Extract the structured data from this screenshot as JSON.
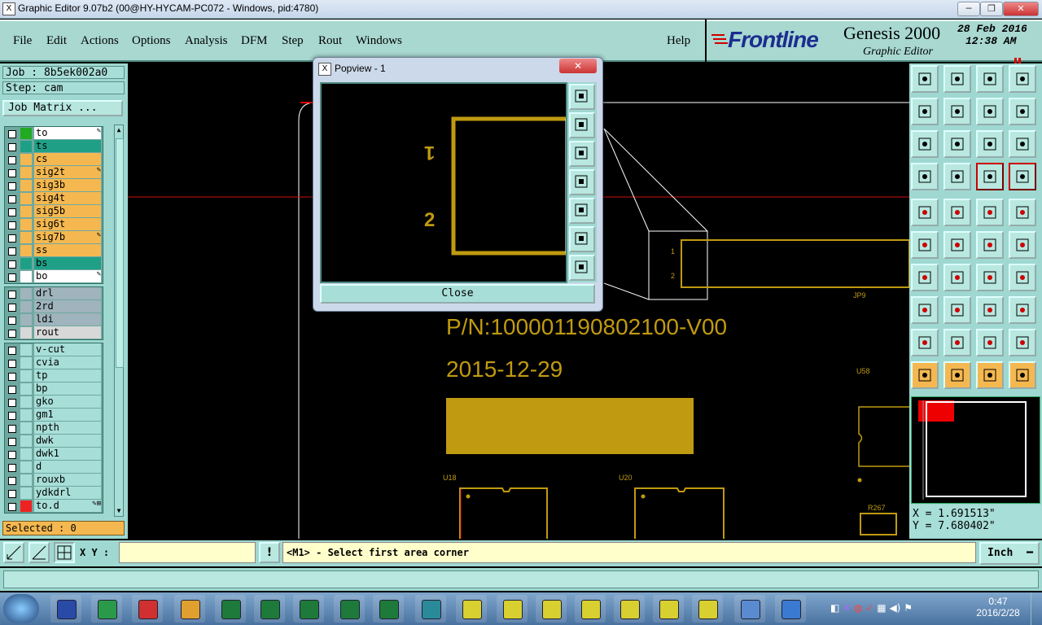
{
  "window": {
    "title": "Graphic Editor 9.07b2 (00@HY-HYCAM-PC072 - Windows, pid:4780)",
    "app_icon": "X",
    "minimize_glyph": "─",
    "restore_glyph": "❐",
    "close_glyph": "✕"
  },
  "menu": [
    "File",
    "Edit",
    "Actions",
    "Options",
    "Analysis",
    "DFM",
    "Step",
    "Rout",
    "Windows"
  ],
  "help": "Help",
  "brand": {
    "logo": "Frontline",
    "product": "Genesis 2000",
    "subtitle": "Graphic Editor",
    "date": "28 Feb 2016",
    "time": "12:38  AM"
  },
  "left": {
    "job": "Job : 8b5ek002a0",
    "step": "Step: cam",
    "job_matrix": "Job Matrix ...",
    "layers_group1": [
      {
        "name": "to",
        "color": "#ffffff",
        "swatch": "#22aa22",
        "flag": "✎"
      },
      {
        "name": "ts",
        "color": "#1fa086",
        "swatch": "#1fa086",
        "flag": ""
      },
      {
        "name": "cs",
        "color": "#f5b850",
        "swatch": "#f5b850",
        "flag": ""
      },
      {
        "name": "sig2t",
        "color": "#f5b850",
        "swatch": "#f5b850",
        "flag": "✎"
      },
      {
        "name": "sig3b",
        "color": "#f5b850",
        "swatch": "#f5b850",
        "flag": ""
      },
      {
        "name": "sig4t",
        "color": "#f5b850",
        "swatch": "#f5b850",
        "flag": ""
      },
      {
        "name": "sig5b",
        "color": "#f5b850",
        "swatch": "#f5b850",
        "flag": ""
      },
      {
        "name": "sig6t",
        "color": "#f5b850",
        "swatch": "#f5b850",
        "flag": ""
      },
      {
        "name": "sig7b",
        "color": "#f5b850",
        "swatch": "#f5b850",
        "flag": "✎"
      },
      {
        "name": "ss",
        "color": "#f5b850",
        "swatch": "#f5b850",
        "flag": ""
      },
      {
        "name": "bs",
        "color": "#1fa086",
        "swatch": "#1fa086",
        "flag": ""
      },
      {
        "name": "bo",
        "color": "#ffffff",
        "swatch": "#ffffff",
        "flag": "✎"
      }
    ],
    "layers_group2": [
      {
        "name": "drl",
        "color": "#9fb4bc",
        "swatch": "#9fb4bc",
        "flag": ""
      },
      {
        "name": "2rd",
        "color": "#9fb4bc",
        "swatch": "#9fb4bc",
        "flag": ""
      },
      {
        "name": "ldi",
        "color": "#9fb4bc",
        "swatch": "#9fb4bc",
        "flag": ""
      },
      {
        "name": "rout",
        "color": "#d8d8d8",
        "swatch": "#d8d8d8",
        "flag": ""
      }
    ],
    "layers_group3": [
      {
        "name": "v-cut",
        "color": "#a8ded8",
        "swatch": "#a8ded8",
        "flag": ""
      },
      {
        "name": "cvia",
        "color": "#a8ded8",
        "swatch": "#a8ded8",
        "flag": ""
      },
      {
        "name": "tp",
        "color": "#a8ded8",
        "swatch": "#a8ded8",
        "flag": ""
      },
      {
        "name": "bp",
        "color": "#a8ded8",
        "swatch": "#a8ded8",
        "flag": ""
      },
      {
        "name": "gko",
        "color": "#a8ded8",
        "swatch": "#a8ded8",
        "flag": ""
      },
      {
        "name": "gm1",
        "color": "#a8ded8",
        "swatch": "#a8ded8",
        "flag": ""
      },
      {
        "name": "npth",
        "color": "#a8ded8",
        "swatch": "#a8ded8",
        "flag": ""
      },
      {
        "name": "dwk",
        "color": "#a8ded8",
        "swatch": "#a8ded8",
        "flag": ""
      },
      {
        "name": "dwk1",
        "color": "#a8ded8",
        "swatch": "#a8ded8",
        "flag": ""
      },
      {
        "name": "d",
        "color": "#a8ded8",
        "swatch": "#a8ded8",
        "flag": ""
      },
      {
        "name": "rouxb",
        "color": "#a8ded8",
        "swatch": "#a8ded8",
        "flag": ""
      },
      {
        "name": "ydkdrl",
        "color": "#a8ded8",
        "swatch": "#a8ded8",
        "flag": ""
      },
      {
        "name": "to.d",
        "color": "#a8ded8",
        "swatch": "#ee2222",
        "flag": "✎⊞"
      }
    ],
    "selected": "Selected : 0"
  },
  "canvas": {
    "pn": "P/N:100001190802100-V00",
    "date": "2015-12-29",
    "labels": {
      "jp9": "JP9",
      "u58": "U58",
      "u18": "U18",
      "u20": "U20",
      "r267": "R267",
      "pin1": "1",
      "pin2": "2"
    }
  },
  "popview": {
    "title": "Popview - 1",
    "close": "Close",
    "pin1": "1",
    "pin2": "2"
  },
  "coords": {
    "x": "X = 1.691513\"",
    "y": "Y = 7.680402\""
  },
  "cmd": {
    "xy_label": "X Y :",
    "xy_value": "",
    "bang": "!",
    "prompt": "<M1> - Select first area corner",
    "units": "Inch"
  },
  "tray": {
    "time": "0:47",
    "date": "2016/2/28"
  },
  "colors": {
    "accent": "#c09a10",
    "panel": "#9fd8d0",
    "red": "#e60000"
  }
}
